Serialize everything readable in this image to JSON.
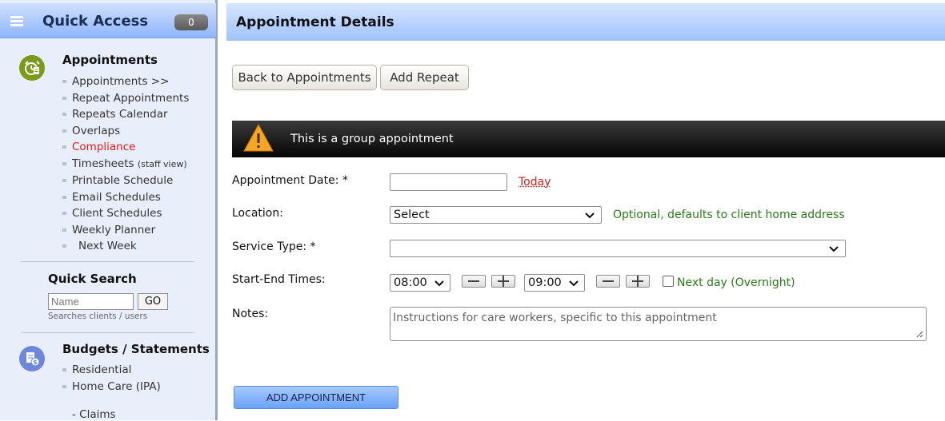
{
  "sidebar": {
    "title": "Quick Access",
    "badge": "0",
    "appointments": {
      "title": "Appointments",
      "links": [
        {
          "label": "Appointments >>"
        },
        {
          "label": "Repeat Appointments"
        },
        {
          "label": "Repeats Calendar"
        },
        {
          "label": "Overlaps"
        },
        {
          "label": "Compliance"
        },
        {
          "label": "Timesheets",
          "note": "(staff view)"
        },
        {
          "label": "Printable Schedule"
        },
        {
          "label": "Email Schedules"
        },
        {
          "label": "Client Schedules"
        },
        {
          "label": "Weekly Planner"
        },
        {
          "label": "Next Week"
        }
      ]
    },
    "quick_search": {
      "title": "Quick Search",
      "placeholder": "Name",
      "button": "GO",
      "hint": "Searches clients / users"
    },
    "budgets": {
      "title": "Budgets / Statements",
      "links": [
        {
          "label": "Residential"
        },
        {
          "label": "Home Care (IPA)"
        }
      ],
      "sub_link": "-  Claims"
    }
  },
  "main": {
    "title": "Appointment Details",
    "buttons": {
      "back": "Back to Appointments",
      "add_repeat": "Add Repeat"
    },
    "warning": "This is a group appointment",
    "form": {
      "date_label": "Appointment Date: *",
      "date_value": "",
      "today_link": "Today",
      "location_label": "Location:",
      "location_value": "Select",
      "location_hint": "Optional, defaults to client home address",
      "service_label": "Service Type: *",
      "service_value": "",
      "times_label": "Start-End Times:",
      "start_time": "08:00",
      "end_time": "09:00",
      "next_day_label": "Next day (Overnight)",
      "next_day_checked": false,
      "notes_label": "Notes:",
      "notes_placeholder": "Instructions for care workers, specific to this appointment"
    },
    "submit": "ADD APPOINTMENT"
  },
  "colors": {
    "header_blue": "#9fc2ff",
    "sidebar_bg": "#e8effa",
    "link_red": "#e21a1a",
    "hint_green": "#2a7a1a",
    "warning_bar": "#050505",
    "appointments_icon": "#7a9a1a",
    "budgets_icon": "#6f87d8"
  },
  "icons": {
    "menu": "hamburger-icon",
    "appointments": "alarm-clock-icon",
    "budgets": "money-document-icon",
    "warning": "warning-triangle-icon"
  }
}
